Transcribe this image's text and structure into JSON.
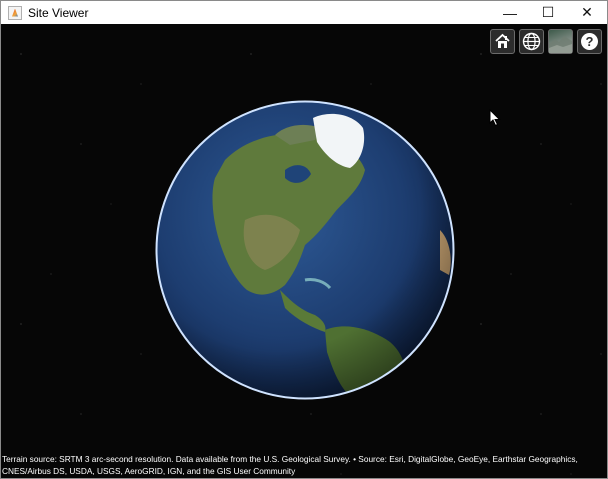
{
  "window": {
    "title": "Site Viewer",
    "controls": {
      "minimize": "—",
      "maximize": "☐",
      "close": "✕"
    }
  },
  "toolbar": {
    "buttons": [
      {
        "name": "home",
        "icon": "home-icon"
      },
      {
        "name": "base-map",
        "icon": "globe-icon"
      },
      {
        "name": "terrain",
        "icon": "terrain-icon"
      },
      {
        "name": "help",
        "icon": "help-icon",
        "glyph": "?"
      }
    ]
  },
  "globe": {
    "description_icon": "earth-globe",
    "colors": {
      "ocean": "#1f3f73",
      "land": "#5f7a3c",
      "ice": "#f2f5f7",
      "rim": "#cfe3ff"
    }
  },
  "attribution": {
    "text": "Terrain source: SRTM 3 arc-second resolution. Data available from the U.S. Geological Survey. • Source: Esri, DigitalGlobe, GeoEye, Earthstar Geographics, CNES/Airbus DS, USDA, USGS, AeroGRID, IGN, and the GIS User Community"
  }
}
